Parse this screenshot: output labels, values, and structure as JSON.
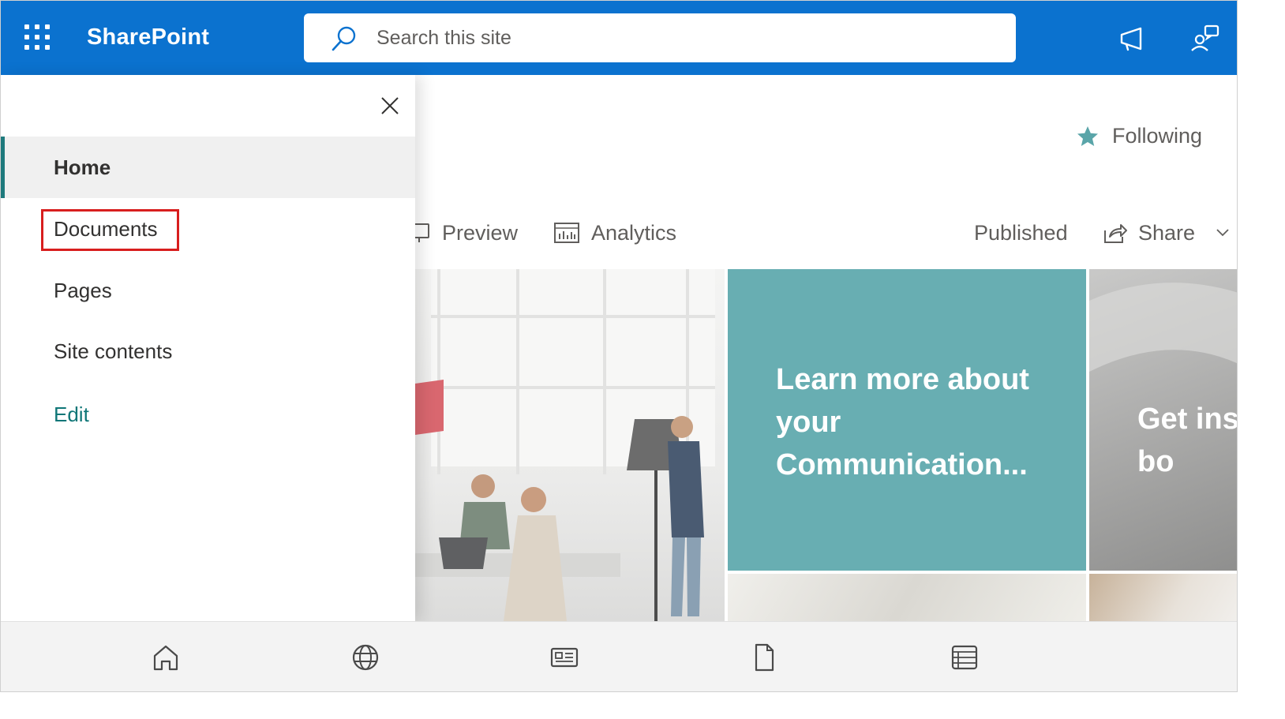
{
  "app": {
    "brand": "SharePoint"
  },
  "search": {
    "placeholder": "Search this site"
  },
  "header": {
    "following_label": "Following"
  },
  "commandbar": {
    "preview_label": "Preview",
    "analytics_label": "Analytics",
    "published_label": "Published",
    "share_label": "Share"
  },
  "hero": {
    "tile_teal_title": "Learn more about your Communication...",
    "tile_grey_title": "Get insp the Sha look bo"
  },
  "nav": {
    "items": [
      {
        "label": "Home",
        "selected": true
      },
      {
        "label": "Documents",
        "highlighted": true
      },
      {
        "label": "Pages"
      },
      {
        "label": "Site contents"
      },
      {
        "label": "Edit"
      }
    ]
  },
  "bottom_nav": {
    "icons": [
      "home-icon",
      "globe-icon",
      "news-icon",
      "document-icon",
      "list-icon"
    ]
  },
  "colors": {
    "suite_bar": "#0b72cf",
    "accent_teal": "#68aeb2",
    "nav_accent": "#1e7a7d",
    "highlight_box": "#d81e1e"
  }
}
